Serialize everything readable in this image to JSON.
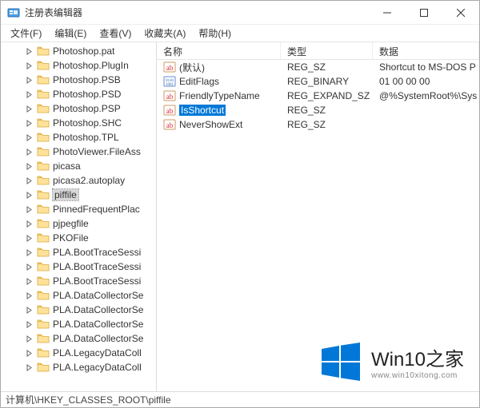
{
  "window": {
    "title": "注册表编辑器"
  },
  "menu": {
    "file": "文件(F)",
    "edit": "编辑(E)",
    "view": "查看(V)",
    "favorites": "收藏夹(A)",
    "help": "帮助(H)"
  },
  "tree": {
    "items": [
      {
        "label": "Photoshop.pat",
        "selected": false
      },
      {
        "label": "Photoshop.PlugIn",
        "selected": false
      },
      {
        "label": "Photoshop.PSB",
        "selected": false
      },
      {
        "label": "Photoshop.PSD",
        "selected": false
      },
      {
        "label": "Photoshop.PSP",
        "selected": false
      },
      {
        "label": "Photoshop.SHC",
        "selected": false
      },
      {
        "label": "Photoshop.TPL",
        "selected": false
      },
      {
        "label": "PhotoViewer.FileAss",
        "selected": false
      },
      {
        "label": "picasa",
        "selected": false
      },
      {
        "label": "picasa2.autoplay",
        "selected": false
      },
      {
        "label": "piffile",
        "selected": true
      },
      {
        "label": "PinnedFrequentPlac",
        "selected": false
      },
      {
        "label": "pjpegfile",
        "selected": false
      },
      {
        "label": "PKOFile",
        "selected": false
      },
      {
        "label": "PLA.BootTraceSessi",
        "selected": false
      },
      {
        "label": "PLA.BootTraceSessi",
        "selected": false
      },
      {
        "label": "PLA.BootTraceSessi",
        "selected": false
      },
      {
        "label": "PLA.DataCollectorSe",
        "selected": false
      },
      {
        "label": "PLA.DataCollectorSe",
        "selected": false
      },
      {
        "label": "PLA.DataCollectorSe",
        "selected": false
      },
      {
        "label": "PLA.DataCollectorSe",
        "selected": false
      },
      {
        "label": "PLA.LegacyDataColl",
        "selected": false
      },
      {
        "label": "PLA.LegacyDataColl",
        "selected": false
      }
    ]
  },
  "list": {
    "columns": {
      "name": "名称",
      "type": "类型",
      "data": "数据"
    },
    "rows": [
      {
        "icon": "ab",
        "name": "(默认)",
        "type": "REG_SZ",
        "data": "Shortcut to MS-DOS P",
        "selected": false
      },
      {
        "icon": "bin",
        "name": "EditFlags",
        "type": "REG_BINARY",
        "data": "01 00 00 00",
        "selected": false
      },
      {
        "icon": "ab",
        "name": "FriendlyTypeName",
        "type": "REG_EXPAND_SZ",
        "data": "@%SystemRoot%\\Sys",
        "selected": false
      },
      {
        "icon": "ab",
        "name": "IsShortcut",
        "type": "REG_SZ",
        "data": "",
        "selected": true
      },
      {
        "icon": "ab",
        "name": "NeverShowExt",
        "type": "REG_SZ",
        "data": "",
        "selected": false
      }
    ]
  },
  "statusbar": {
    "path": "计算机\\HKEY_CLASSES_ROOT\\piffile"
  },
  "watermark": {
    "brand": "Win10之家",
    "url": "www.win10xitong.com"
  }
}
